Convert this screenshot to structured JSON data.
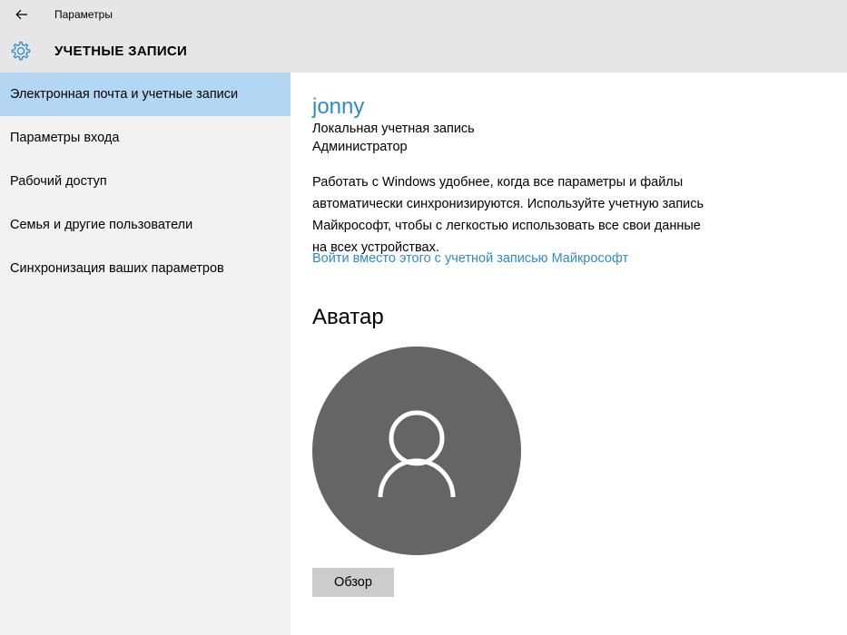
{
  "window": {
    "title": "Параметры",
    "back_icon": "arrow-left-icon"
  },
  "header": {
    "icon": "gear-icon",
    "title": "УЧЕТНЫЕ ЗАПИСИ"
  },
  "sidebar": {
    "items": [
      {
        "label": "Электронная почта и учетные записи",
        "selected": true
      },
      {
        "label": "Параметры входа",
        "selected": false
      },
      {
        "label": "Рабочий доступ",
        "selected": false
      },
      {
        "label": "Семья и другие пользователи",
        "selected": false
      },
      {
        "label": "Синхронизация ваших параметров",
        "selected": false
      }
    ]
  },
  "account": {
    "name": "jonny",
    "type": "Локальная учетная запись",
    "role": "Администратор",
    "sync_lines": [
      "Работать с Windows удобнее, когда все параметры и файлы",
      "автоматически синхронизируются. Используйте учетную запись",
      "Майкрософт, чтобы с легкостью использовать все свои данные",
      "на всех устройствах."
    ],
    "ms_link": "Войти вместо этого с учетной записью Майкрософт"
  },
  "avatar": {
    "heading": "Аватар",
    "icon": "user-silhouette-icon",
    "browse_label": "Обзор"
  },
  "colors": {
    "accent": "#2e8bc9",
    "selection": "#b3d7f3",
    "avatar_bg": "#656565"
  }
}
